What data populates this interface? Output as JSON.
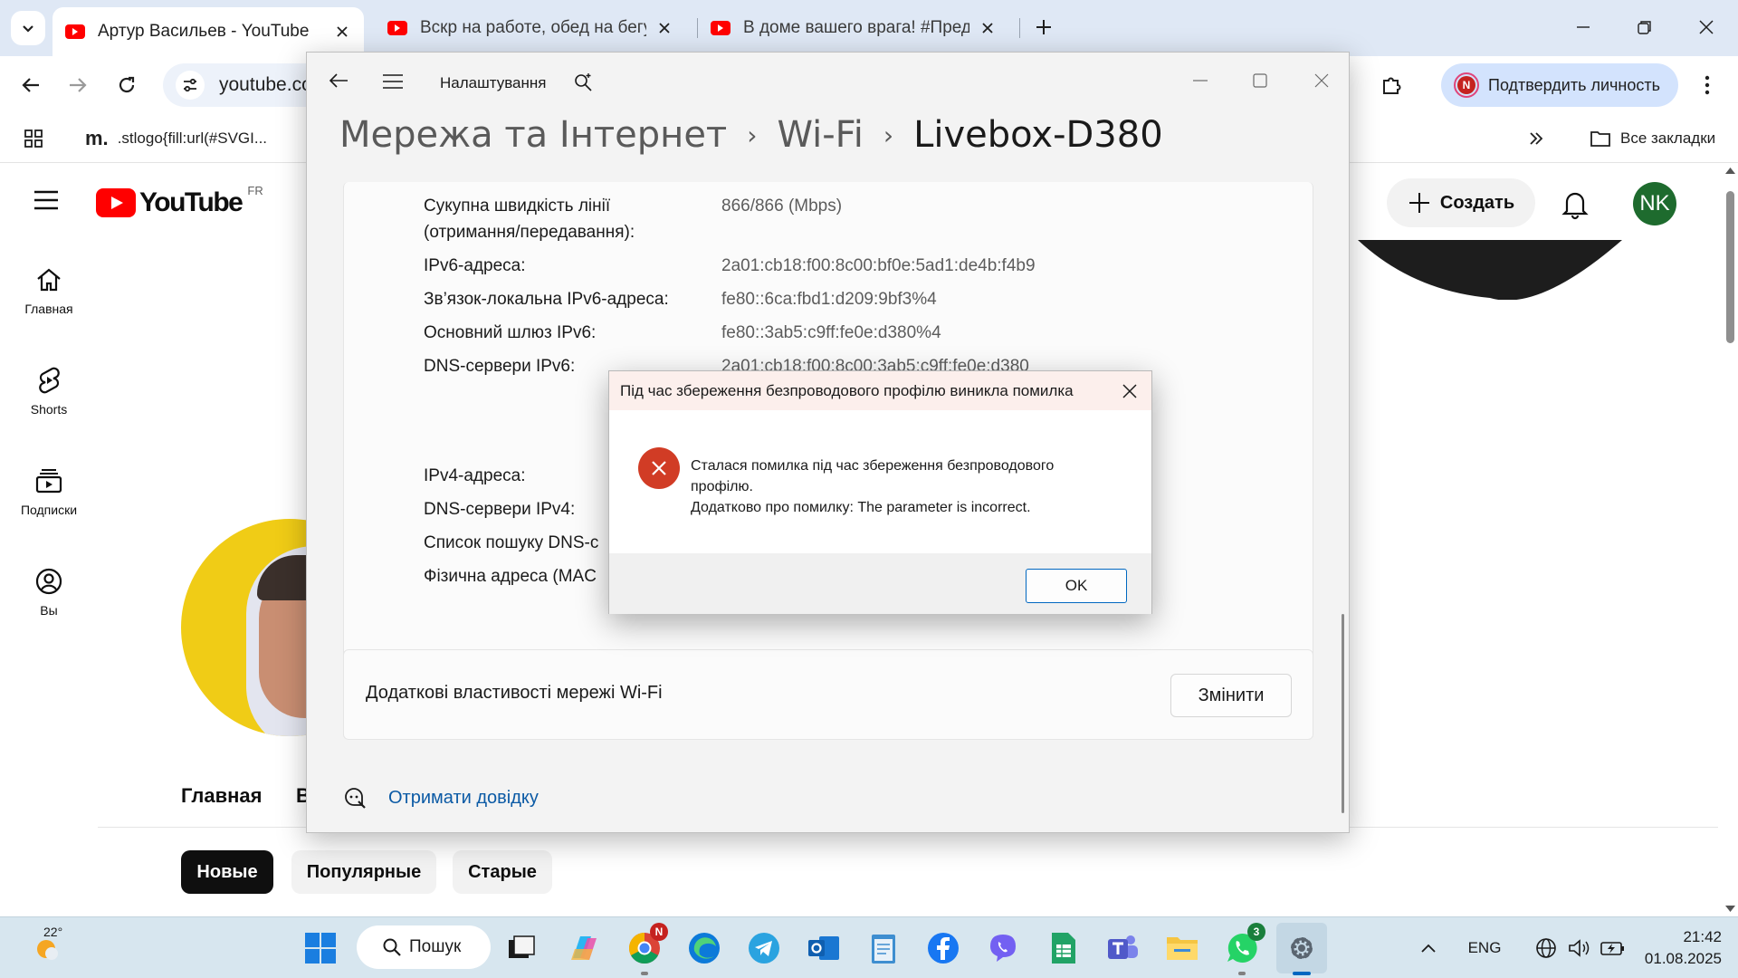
{
  "browser": {
    "tabs": [
      {
        "title": "Артур Васильев - YouTube",
        "active": true
      },
      {
        "title": "Вскр на работе, обед на бегу, "
      },
      {
        "title": "В доме вашего врага! #Предс"
      }
    ],
    "address": "youtube.co",
    "verify_label": "Подтвердить личность",
    "verify_avatar": "N",
    "bookmarks": [
      {
        "label": ".stlogo{fill:url(#SVGI..."
      }
    ],
    "all_bookmarks_label": "Все закладки"
  },
  "youtube": {
    "logo_word": "YouTube",
    "logo_country": "FR",
    "sidebar": [
      {
        "label": "Главная",
        "icon": "home-icon"
      },
      {
        "label": "Shorts",
        "icon": "shorts-icon"
      },
      {
        "label": "Подписки",
        "icon": "subscriptions-icon"
      },
      {
        "label": "Вы",
        "icon": "you-icon"
      }
    ],
    "create_label": "Создать",
    "user_initials": "NK",
    "channel_tab_visible": "Главная",
    "channel_tab_cut": "В",
    "chips": [
      "Новые",
      "Популярные",
      "Старые"
    ]
  },
  "settings": {
    "title": "Налаштування",
    "breadcrumb": [
      "Мережа та Інтернет",
      "Wi-Fi",
      "Livebox-D380"
    ],
    "properties": [
      {
        "label": "Сукупна швидкість лінії",
        "label2": "(отримання/передавання):",
        "value": "866/866 (Mbps)"
      },
      {
        "label": "IPv6-адреса:",
        "value": "2a01:cb18:f00:8c00:bf0e:5ad1:de4b:f4b9"
      },
      {
        "label": "Зв’язок-локальна IPv6-адреса:",
        "value": "fe80::6ca:fbd1:d209:9bf3%4"
      },
      {
        "label": "Основний шлюз IPv6:",
        "value": "fe80::3ab5:c9ff:fe0e:d380%4"
      },
      {
        "label": "DNS-сервери IPv6:",
        "value": "2a01:cb18:f00:8c00:3ab5:c9ff:fe0e:d380"
      },
      {
        "label": "IPv4-адреса:",
        "value": ""
      },
      {
        "label": "DNS-сервери IPv4:",
        "value": ""
      },
      {
        "label": "Список пошуку DNS-с",
        "value": ""
      },
      {
        "label": "Фізична адреса (MAC",
        "value": ""
      }
    ],
    "advanced_label": "Додаткові властивості мережі Wi-Fi",
    "change_label": "Змінити",
    "help_label": "Отримати довідку"
  },
  "dialog": {
    "title": "Під час збереження безпроводового профілю виникла помилка",
    "line1": "Сталася помилка під час збереження безпроводового",
    "line2": "профілю.",
    "line3": "Додатково про помилку: The parameter is incorrect.",
    "ok_label": "OK"
  },
  "taskbar": {
    "weather_temp": "22°",
    "search_label": "Пошук",
    "chrome_badge": "N",
    "whatsapp_badge": "3",
    "lang": "ENG",
    "time": "21:42",
    "date": "01.08.2025"
  },
  "colors": {
    "youtube_red": "#ff0000",
    "settings_accent": "#0067c0",
    "error_red": "#d13c25",
    "avatar_green": "#1e6b2e"
  }
}
